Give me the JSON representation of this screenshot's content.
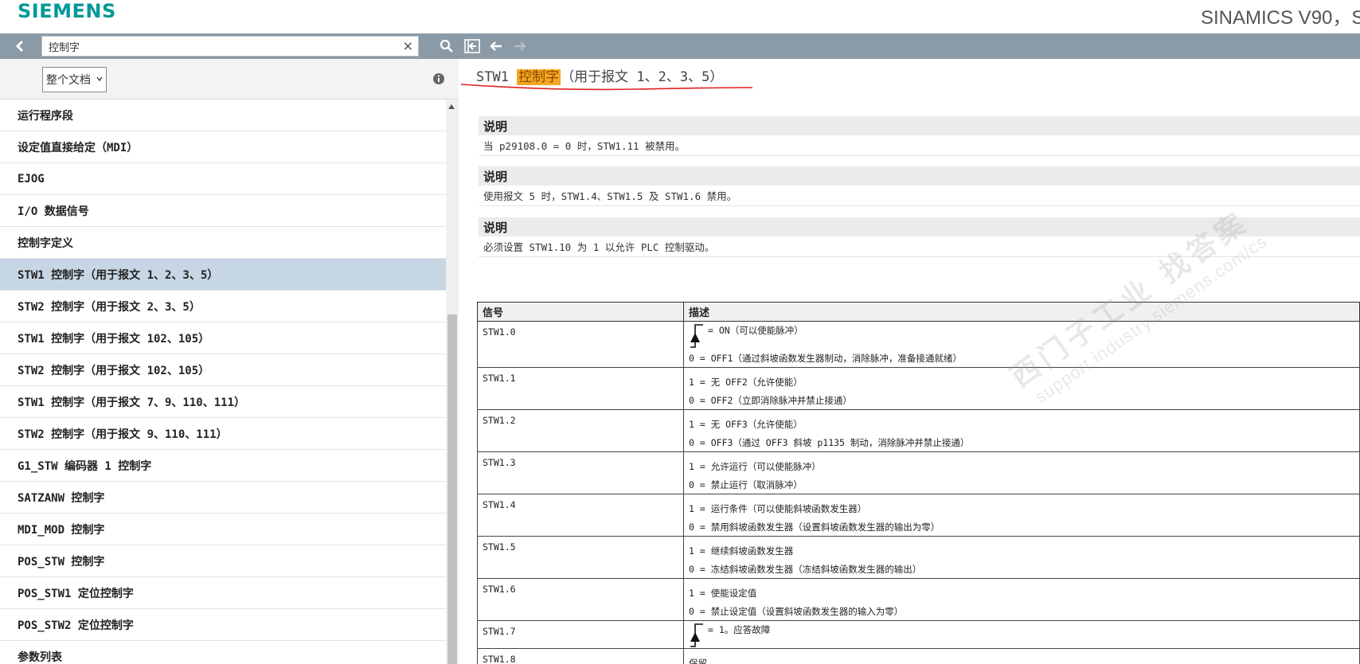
{
  "header": {
    "logo": "SIEMENS",
    "product": "SINAMICS V90，S"
  },
  "toolbar": {
    "search_value": "控制字",
    "clear_label": "×"
  },
  "sidebar": {
    "scope_label": "整个文档",
    "items": [
      "运行程序段",
      "设定值直接给定（MDI）",
      "EJOG",
      "I/O 数据信号",
      "控制字定义",
      "STW1 控制字（用于报文 1、2、3、5）",
      "STW2 控制字（用于报文 2、3、5）",
      "STW1 控制字（用于报文 102、105）",
      "STW2 控制字（用于报文 102、105）",
      "STW1 控制字（用于报文 7、9、110、111）",
      "STW2 控制字（用于报文 9、110、111）",
      "G1_STW 编码器 1 控制字",
      "SATZANW 控制字",
      "MDI_MOD 控制字",
      "POS_STW 控制字",
      "POS_STW1 定位控制字",
      "POS_STW2 定位控制字",
      "参数列表"
    ],
    "active_index": 5
  },
  "main": {
    "title_prefix": "STW1 ",
    "title_highlight": "控制字",
    "title_suffix": "（用于报文 1、2、3、5）",
    "notes": [
      {
        "head": "说明",
        "body": "当 p29108.0 = 0 时，STW1.11 被禁用。"
      },
      {
        "head": "说明",
        "body": "使用报文 5 时，STW1.4、STW1.5 及 STW1.6 禁用。"
      },
      {
        "head": "说明",
        "body": "必须设置 STW1.10 为 1 以允许 PLC 控制驱动。"
      }
    ],
    "table": {
      "col_signal": "信号",
      "col_desc": "描述",
      "rows": [
        {
          "signal": "STW1.0",
          "edge": "= ON（可以使能脉冲）",
          "lines": [
            "0 = OFF1（通过斜坡函数发生器制动，消除脉冲，准备接通就绪）"
          ]
        },
        {
          "signal": "STW1.1",
          "edge": "",
          "lines": [
            "1 = 无 OFF2（允许使能）",
            "0 = OFF2（立即消除脉冲并禁止接通）"
          ]
        },
        {
          "signal": "STW1.2",
          "edge": "",
          "lines": [
            "1 = 无 OFF3（允许使能）",
            "0 = OFF3（通过 OFF3 斜坡 p1135 制动，消除脉冲并禁止接通）"
          ]
        },
        {
          "signal": "STW1.3",
          "edge": "",
          "lines": [
            "1 = 允许运行（可以使能脉冲）",
            "0 = 禁止运行（取消脉冲）"
          ]
        },
        {
          "signal": "STW1.4",
          "edge": "",
          "lines": [
            "1 = 运行条件（可以使能斜坡函数发生器）",
            "0 = 禁用斜坡函数发生器（设置斜坡函数发生器的输出为零）"
          ]
        },
        {
          "signal": "STW1.5",
          "edge": "",
          "lines": [
            "1 = 继续斜坡函数发生器",
            "0 = 冻结斜坡函数发生器（冻结斜坡函数发生器的输出）"
          ]
        },
        {
          "signal": "STW1.6",
          "edge": "",
          "lines": [
            "1 = 使能设定值",
            "0 = 禁止设定值（设置斜坡函数发生器的输入为零）"
          ]
        },
        {
          "signal": "STW1.7",
          "edge": "= 1。应答故障",
          "lines": []
        },
        {
          "signal": "STW1.8",
          "edge": "",
          "lines": [
            "保留"
          ]
        }
      ]
    }
  },
  "watermark": {
    "cn": "西门子工业 找答案",
    "url": "support.industry.siemens.com/cs"
  }
}
